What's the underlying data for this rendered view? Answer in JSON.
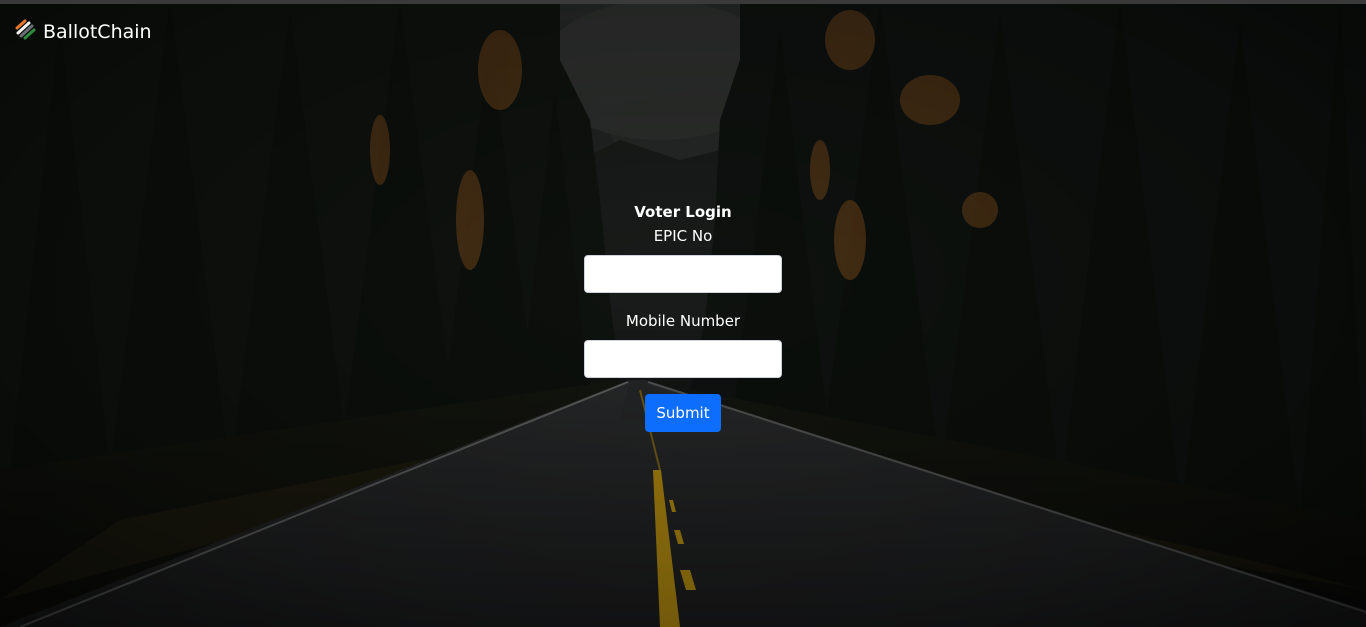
{
  "navbar": {
    "brand_name": "BallotChain",
    "brand_icon": "tricolor-stripes-icon"
  },
  "login": {
    "title": "Voter Login",
    "epic_label": "EPIC No",
    "epic_value": "",
    "mobile_label": "Mobile Number",
    "mobile_value": "",
    "submit_label": "Submit"
  },
  "background": {
    "description_icon": "forest-road-background",
    "accent_color": "#0d6efd"
  }
}
